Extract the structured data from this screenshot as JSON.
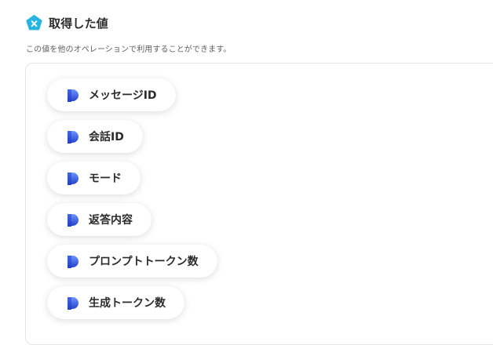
{
  "section": {
    "title": "取得した値",
    "description": "この値を他のオペレーションで利用することができます。",
    "header_icon": "variable-x-icon",
    "header_icon_color": "#26b4e0"
  },
  "values": {
    "item_icon": "data-value-icon",
    "item_icon_color": "#2a4fd8",
    "items": [
      {
        "label": "メッセージID"
      },
      {
        "label": "会話ID"
      },
      {
        "label": "モード"
      },
      {
        "label": "返答内容"
      },
      {
        "label": "プロンプトトークン数"
      },
      {
        "label": "生成トークン数"
      }
    ]
  }
}
